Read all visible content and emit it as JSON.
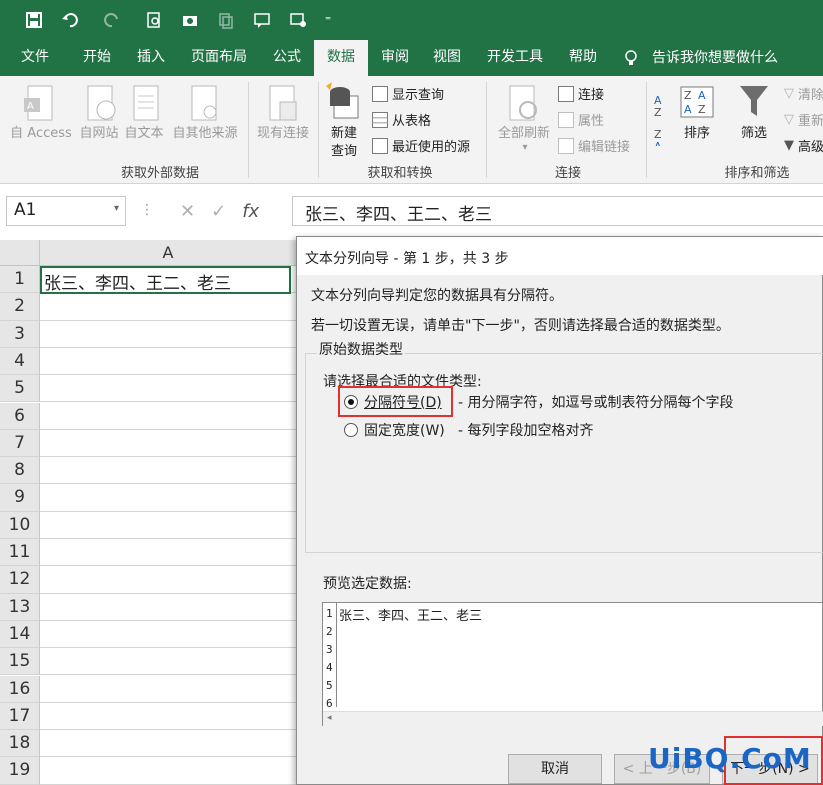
{
  "tabs": [
    "文件",
    "开始",
    "插入",
    "页面布局",
    "公式",
    "数据",
    "审阅",
    "视图",
    "开发工具",
    "帮助"
  ],
  "active_tab": "数据",
  "tell_me": "告诉我你想要做什么",
  "ribbon": {
    "get_external": {
      "label": "获取外部数据",
      "buttons": [
        "自 Access",
        "自网站",
        "自文本",
        "自其他来源",
        "现有连接"
      ]
    },
    "get_transform": {
      "label": "获取和转换",
      "new_query": "新建",
      "new_query2": "查询",
      "show_query": "显示查询",
      "from_table": "从表格",
      "recent_sources": "最近使用的源"
    },
    "connections": {
      "label": "连接",
      "refresh_all": "全部刷新",
      "connections": "连接",
      "properties": "属性",
      "edit_links": "编辑链接"
    },
    "sort_filter": {
      "label": "排序和筛选",
      "sort": "排序",
      "filter": "筛选",
      "clear": "清除",
      "reapply": "重新",
      "advanced": "高级"
    }
  },
  "formula_bar": {
    "name_box": "A1",
    "fx": "fx",
    "content": "张三、李四、王二、老三"
  },
  "grid": {
    "column": "A",
    "rows": [
      "1",
      "2",
      "3",
      "4",
      "5",
      "6",
      "7",
      "8",
      "9",
      "10",
      "11",
      "12",
      "13",
      "14",
      "15",
      "16",
      "17",
      "18",
      "19"
    ],
    "a1": "张三、李四、王二、老三"
  },
  "dialog": {
    "title": "文本分列向导 - 第 1 步，共 3 步",
    "line1": "文本分列向导判定您的数据具有分隔符。",
    "line2": "若一切设置无误，请单击\"下一步\"，否则请选择最合适的数据类型。",
    "group_label": "原始数据类型",
    "choose_label": "请选择最合适的文件类型:",
    "option1": "分隔符号(D)",
    "option1_desc": "- 用分隔字符，如逗号或制表符分隔每个字段",
    "option2": "固定宽度(W)",
    "option2_desc": "- 每列字段加空格对齐",
    "preview_label": "预览选定数据:",
    "preview_nums": [
      "1",
      "2",
      "3",
      "4",
      "5",
      "6"
    ],
    "preview_line1": "张三、李四、王二、老三",
    "cancel": "取消",
    "back": "< 上一步(B)",
    "next": "下一步(N) >"
  },
  "watermark": "UiBQ.CoM"
}
